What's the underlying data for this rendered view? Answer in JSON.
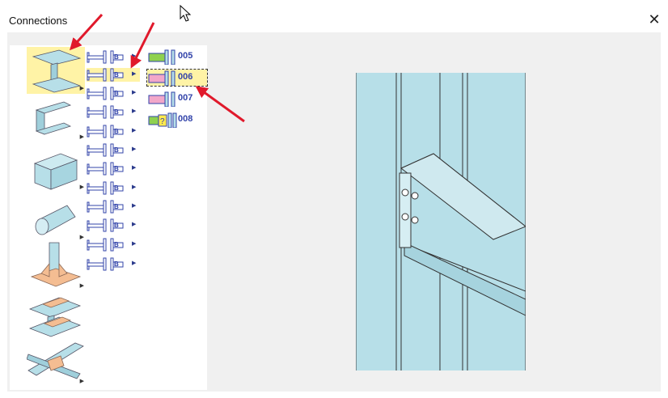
{
  "window": {
    "title": "Connections",
    "close_glyph": "✕"
  },
  "categories": [
    {
      "name": "i-beam-joint",
      "selected": true
    },
    {
      "name": "channel-joint",
      "selected": false
    },
    {
      "name": "hollow-section-joint",
      "selected": false
    },
    {
      "name": "tube-joint",
      "selected": false
    },
    {
      "name": "base-plate-joint",
      "selected": false
    },
    {
      "name": "splice-joint",
      "selected": false
    },
    {
      "name": "truss-joint",
      "selected": false
    }
  ],
  "subtypes": [
    {
      "badge": "B",
      "selected": false
    },
    {
      "badge": "B",
      "selected": true
    },
    {
      "badge": "B",
      "selected": false
    },
    {
      "badge": "B",
      "selected": false
    },
    {
      "badge": "B",
      "selected": false
    },
    {
      "badge": "B",
      "selected": false
    },
    {
      "badge": "B",
      "selected": false
    },
    {
      "badge": "B",
      "selected": false
    },
    {
      "badge": "B",
      "selected": false
    },
    {
      "badge": "B",
      "selected": false
    },
    {
      "badge": "B",
      "selected": false
    },
    {
      "badge": "B",
      "selected": false
    }
  ],
  "connections": [
    {
      "number": "005",
      "color": "#8fd14f",
      "selected": false
    },
    {
      "number": "006",
      "color": "#f2a7c9",
      "selected": true
    },
    {
      "number": "007",
      "color": "#f2a7c9",
      "selected": false
    },
    {
      "number": "008",
      "color": "#8fd14f",
      "mark": "?",
      "selected": false
    }
  ],
  "colors": {
    "steel": "#b7dfe8",
    "highlight": "#fff3a6",
    "accent": "#3344aa",
    "annotation": "#e0192b"
  }
}
